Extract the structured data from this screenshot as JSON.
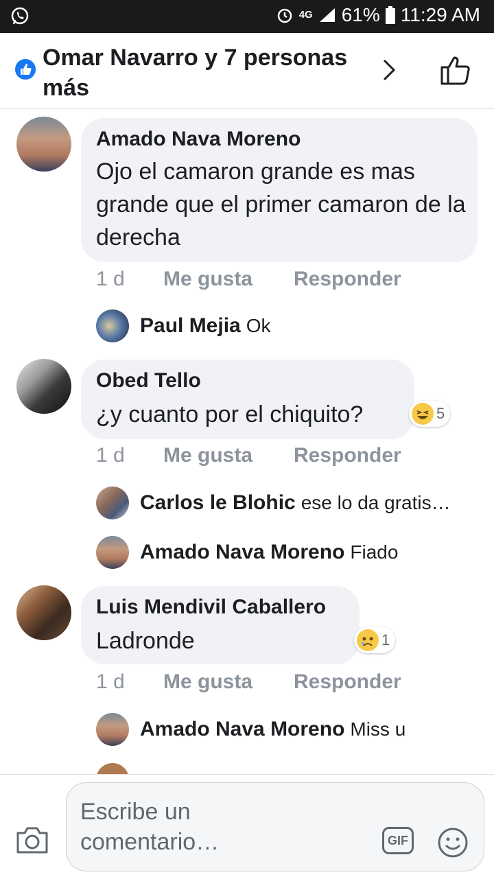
{
  "status_bar": {
    "network": "4G",
    "battery": "61%",
    "time": "11:29 AM"
  },
  "header": {
    "title": "Omar Navarro y 7 personas más"
  },
  "comments": [
    {
      "author": "Amado Nava Moreno",
      "text": "Ojo el camaron grande es mas grande que el primer camaron de la derecha",
      "time": "1 d",
      "like": "Me gusta",
      "reply": "Responder",
      "replies": [
        {
          "author": "Paul Mejia",
          "text": "Ok"
        }
      ]
    },
    {
      "author": "Obed Tello",
      "text": "¿y cuanto por el chiquito?",
      "time": "1 d",
      "like": "Me gusta",
      "reply": "Responder",
      "reaction": {
        "icon": "laugh-emoji-icon",
        "count": "5"
      },
      "replies": [
        {
          "author": "Carlos le Blohic",
          "text": "ese lo da gratis…"
        },
        {
          "author": "Amado Nava Moreno",
          "text": "Fiado"
        }
      ]
    },
    {
      "author": "Luis Mendivil Caballero",
      "text": "Ladronde",
      "time": "1 d",
      "like": "Me gusta",
      "reply": "Responder",
      "reaction": {
        "icon": "sad-emoji-icon",
        "count": "1"
      },
      "replies": [
        {
          "author": "Amado Nava Moreno",
          "text": "Miss u"
        }
      ]
    }
  ],
  "composer": {
    "placeholder": "Escribe un comentario…",
    "gif_label": "GIF"
  },
  "colors": {
    "facebook_blue": "#1877f2",
    "bubble": "#f0f2f5",
    "meta_gray": "#8d949e"
  }
}
